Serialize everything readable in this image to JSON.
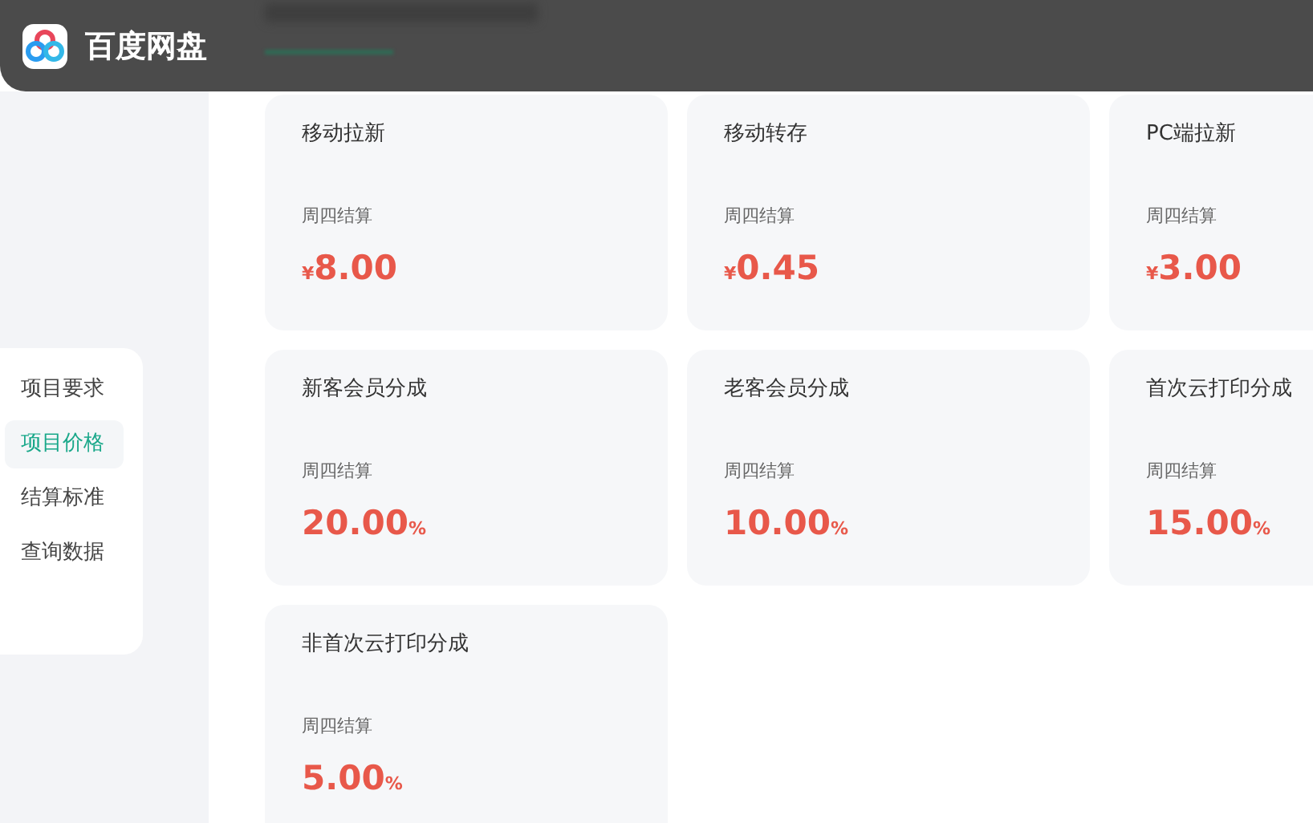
{
  "header": {
    "title": "百度网盘"
  },
  "sidebar": {
    "items": [
      {
        "label": "项目要求",
        "selected": false
      },
      {
        "label": "项目价格",
        "selected": true
      },
      {
        "label": "结算标准",
        "selected": false
      },
      {
        "label": "查询数据",
        "selected": false
      }
    ]
  },
  "cards": [
    {
      "title": "移动拉新",
      "note": "周四结算",
      "prefix": "¥",
      "value": "8.00"
    },
    {
      "title": "移动转存",
      "note": "周四结算",
      "prefix": "¥",
      "value": "0.45"
    },
    {
      "title": "PC端拉新",
      "note": "周四结算",
      "prefix": "¥",
      "value": "3.00"
    },
    {
      "title": "新客会员分成",
      "note": "周四结算",
      "value": "20.00",
      "suffix": "%"
    },
    {
      "title": "老客会员分成",
      "note": "周四结算",
      "value": "10.00",
      "suffix": "%"
    },
    {
      "title": "首次云打印分成",
      "note": "周四结算",
      "value": "15.00",
      "suffix": "%"
    },
    {
      "title": "非首次云打印分成",
      "note": "周四结算",
      "value": "5.00",
      "suffix": "%"
    }
  ]
}
